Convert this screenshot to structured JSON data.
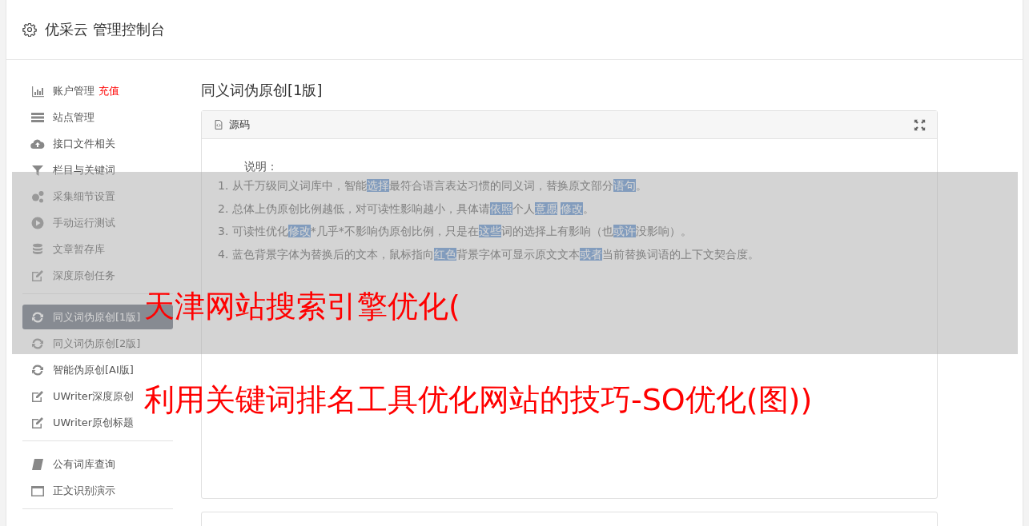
{
  "header": {
    "title": "优采云 管理控制台"
  },
  "sidebar": {
    "groups": [
      {
        "items": [
          {
            "label": "账户管理",
            "badge": "充值",
            "selected": false
          },
          {
            "label": "站点管理",
            "selected": false
          },
          {
            "label": "接口文件相关",
            "selected": false
          },
          {
            "label": "栏目与关键词",
            "selected": false
          },
          {
            "label": "采集细节设置",
            "selected": false
          },
          {
            "label": "手动运行测试",
            "selected": false
          },
          {
            "label": "文章暂存库",
            "selected": false
          },
          {
            "label": "深度原创任务",
            "selected": false
          }
        ]
      },
      {
        "items": [
          {
            "label": "同义词伪原创[1版]",
            "selected": true
          },
          {
            "label": "同义词伪原创[2版]",
            "selected": false
          },
          {
            "label": "智能伪原创[AI版]",
            "selected": false
          },
          {
            "label": "UWriter深度原创",
            "selected": false
          },
          {
            "label": "UWriter原创标题",
            "selected": false
          }
        ]
      },
      {
        "items": [
          {
            "label": "公有词库查询",
            "selected": false
          },
          {
            "label": "正文识别演示",
            "selected": false
          }
        ]
      }
    ]
  },
  "page_title": "同义词伪原创[1版]",
  "panel": {
    "title": "源码",
    "intro": "说明：",
    "lines": [
      "1. 从千万级同义词库中，智能**选择**最符合语言表达习惯的同义词，替换原文部分**语句**。",
      "2. 总体上伪原创比例越低，对可读性影响越小，具体请**依照**个人**意愿** **修改**。",
      "3. 可读性优化**修改***几乎*不影响伪原创比例，只是在**这些**词的选择上有影响（也**或许**没影响）。",
      "4. 蓝色背景字体为替换后的文本，鼠标指向**红色**背景字体可显示原文文本**或者**当前替换词语的上下文契合度。"
    ]
  },
  "overlay": {
    "lines": [
      "天津网站搜索引擎优化(",
      "利用关键词排名工具优化网站的技巧-SO优化(图))"
    ]
  }
}
